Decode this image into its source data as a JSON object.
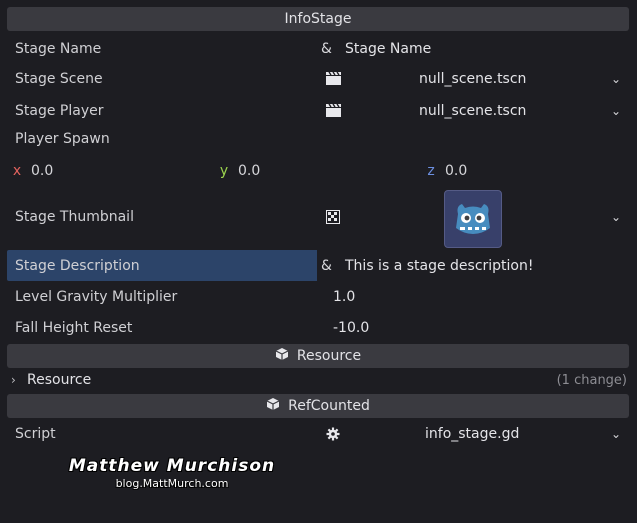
{
  "sections": {
    "info_stage": "InfoStage",
    "resource": "Resource",
    "ref_counted": "RefCounted"
  },
  "properties": {
    "stage_name": {
      "label": "Stage Name",
      "value": "Stage Name"
    },
    "stage_scene": {
      "label": "Stage Scene",
      "value": "null_scene.tscn"
    },
    "stage_player": {
      "label": "Stage Player",
      "value": "null_scene.tscn"
    },
    "player_spawn": {
      "label": "Player Spawn",
      "x": "0.0",
      "y": "0.0",
      "z": "0.0"
    },
    "stage_thumbnail": {
      "label": "Stage Thumbnail"
    },
    "stage_description": {
      "label": "Stage Description",
      "value": "This is a stage description!"
    },
    "level_gravity": {
      "label": "Level Gravity Multiplier",
      "value": "1.0"
    },
    "fall_height": {
      "label": "Fall Height Reset",
      "value": "-10.0"
    }
  },
  "resource_group": {
    "label": "Resource",
    "changes": "(1 change)"
  },
  "script": {
    "label": "Script",
    "value": "info_stage.gd"
  },
  "glyphs": {
    "amp": "&",
    "x": "x",
    "y": "y",
    "z": "z"
  },
  "watermark": {
    "name": "Matthew Murchison",
    "site": "blog.MattMurch.com"
  }
}
